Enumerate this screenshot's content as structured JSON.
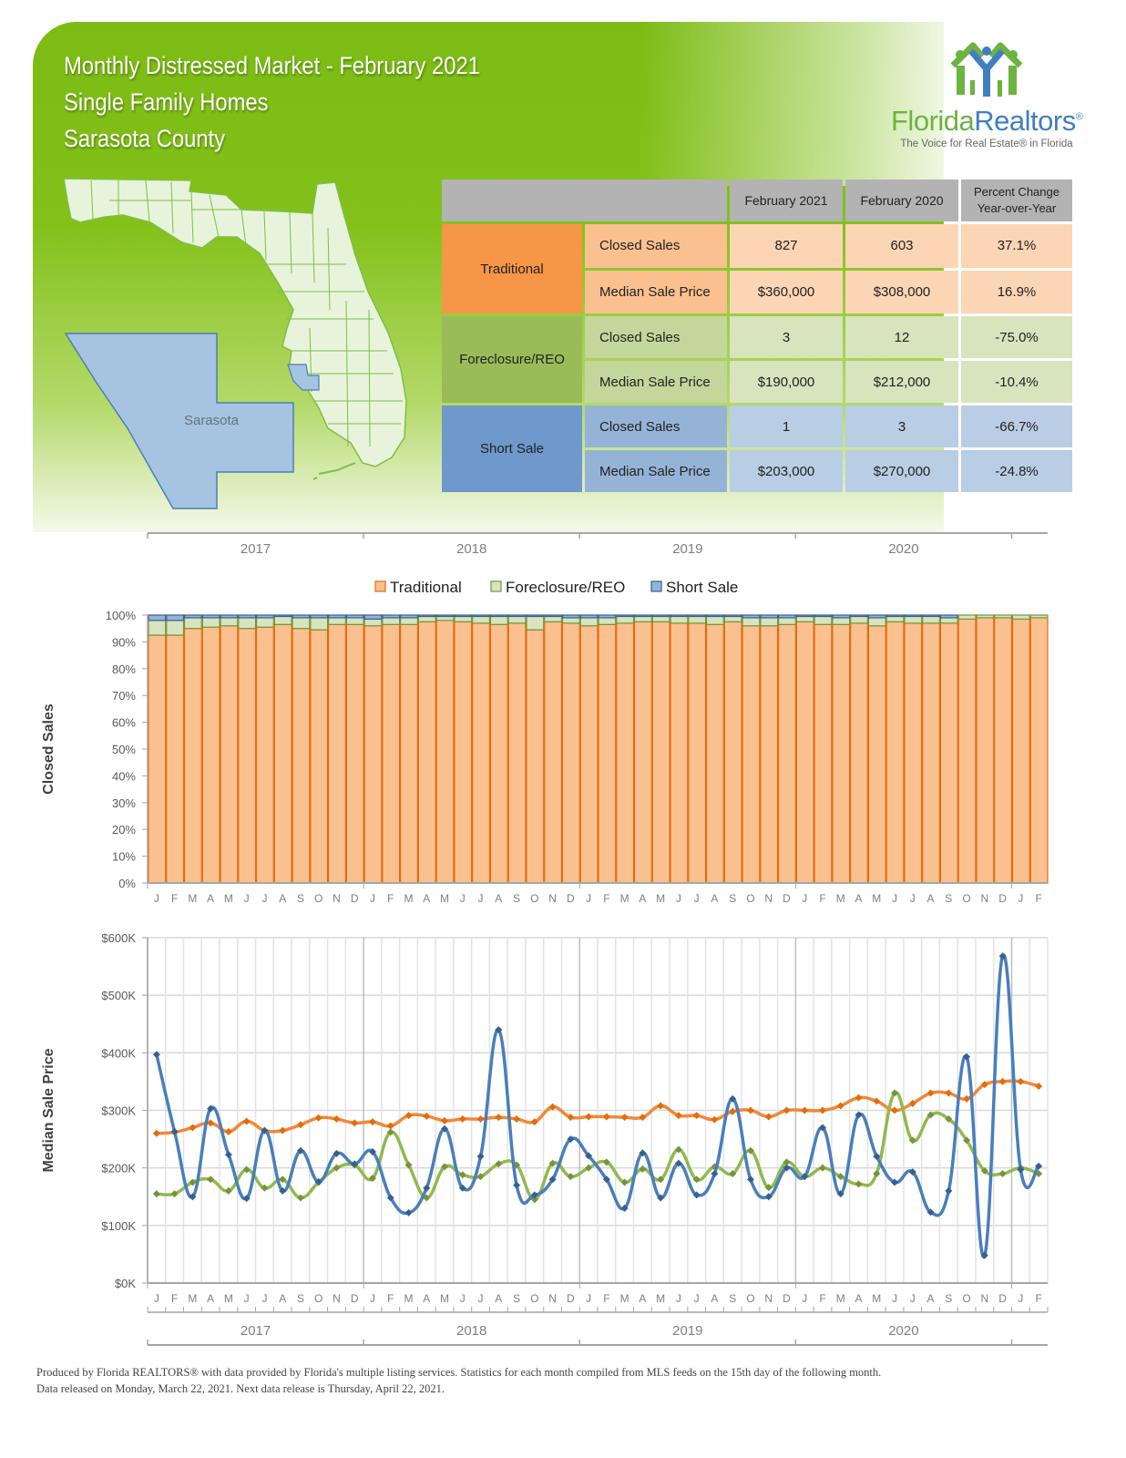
{
  "header": {
    "title_lines": [
      "Monthly Distressed Market - February 2021",
      "Single Family Homes",
      "Sarasota County"
    ]
  },
  "logo": {
    "icon": "houses-people-icon",
    "brand_part1": "Florida",
    "brand_part2": "Realtors",
    "registered": "®",
    "tagline": "The Voice for Real Estate® in Florida"
  },
  "map": {
    "region_label": "Sarasota",
    "state": "Florida",
    "colors": {
      "state_fill": "#e8f3dc",
      "state_border": "#7dbf44",
      "county_fill": "#a6c4e2",
      "county_border": "#4a7fb5"
    }
  },
  "summary_table": {
    "columns": [
      "February 2021",
      "February 2020",
      "Percent Change Year-over-Year"
    ],
    "pct_header_lines": [
      "Percent Change",
      "Year-over-Year"
    ],
    "groups": [
      {
        "category": "Traditional",
        "rows": [
          {
            "metric": "Closed Sales",
            "current": "827",
            "prior": "603",
            "change": "37.1%"
          },
          {
            "metric": "Median Sale Price",
            "current": "$360,000",
            "prior": "$308,000",
            "change": "16.9%"
          }
        ]
      },
      {
        "category": "Foreclosure/REO",
        "rows": [
          {
            "metric": "Closed Sales",
            "current": "3",
            "prior": "12",
            "change": "-75.0%"
          },
          {
            "metric": "Median Sale Price",
            "current": "$190,000",
            "prior": "$212,000",
            "change": "-10.4%"
          }
        ]
      },
      {
        "category": "Short Sale",
        "rows": [
          {
            "metric": "Closed Sales",
            "current": "1",
            "prior": "3",
            "change": "-66.7%"
          },
          {
            "metric": "Median Sale Price",
            "current": "$203,000",
            "prior": "$270,000",
            "change": "-24.8%"
          }
        ]
      }
    ]
  },
  "chart_data": [
    {
      "type": "bar",
      "stacked": "percent",
      "title": "",
      "ylabel": "Closed Sales",
      "xlabel": "",
      "ylim": [
        0,
        100
      ],
      "yticks": [
        "0%",
        "10%",
        "20%",
        "30%",
        "40%",
        "50%",
        "60%",
        "70%",
        "80%",
        "90%",
        "100%"
      ],
      "month_labels": [
        "J",
        "F",
        "M",
        "A",
        "M",
        "J",
        "J",
        "A",
        "S",
        "O",
        "N",
        "D",
        "J",
        "F",
        "M",
        "A",
        "M",
        "J",
        "J",
        "A",
        "S",
        "O",
        "N",
        "D",
        "J",
        "F",
        "M",
        "A",
        "M",
        "J",
        "J",
        "A",
        "S",
        "O",
        "N",
        "D",
        "J",
        "F",
        "M",
        "A",
        "M",
        "J",
        "J",
        "A",
        "S",
        "O",
        "N",
        "D",
        "J",
        "F"
      ],
      "year_labels": [
        "2017",
        "2018",
        "2019",
        "2020"
      ],
      "legend": [
        "Traditional",
        "Foreclosure/REO",
        "Short Sale"
      ],
      "legend_position": "top",
      "grid": true,
      "colors": {
        "Traditional": "#fac090",
        "Foreclosure/REO": "#d7e4bd",
        "Short Sale": "#95b3d7"
      },
      "border_colors": {
        "Traditional": "#e46c0a",
        "Foreclosure/REO": "#77933c",
        "Short Sale": "#376092"
      },
      "series": [
        {
          "name": "Traditional",
          "values": [
            92.5,
            92.5,
            95,
            95.5,
            96,
            95,
            95.5,
            96.5,
            95,
            94.5,
            96.5,
            96.5,
            96,
            96.5,
            96.5,
            97.5,
            98,
            97.5,
            97,
            96.5,
            97,
            94.5,
            97.5,
            97,
            96,
            96.5,
            97,
            97.5,
            97.5,
            97,
            97,
            96.5,
            97.5,
            96,
            96,
            96.5,
            97.5,
            96.5,
            96.5,
            97,
            96,
            97.5,
            97,
            97,
            97,
            98.5,
            99,
            99,
            98.5,
            99
          ]
        },
        {
          "name": "Foreclosure/REO",
          "values": [
            5.5,
            5.5,
            4,
            3.5,
            3,
            4,
            3.5,
            3,
            4,
            4.5,
            2.5,
            2.5,
            2.5,
            2.5,
            2.5,
            2,
            1.5,
            2,
            2.5,
            3,
            2.5,
            5,
            2,
            2,
            3,
            2.5,
            2.5,
            2,
            2,
            2.5,
            2.5,
            3,
            2,
            3,
            3,
            2.5,
            2,
            3,
            2.5,
            2.5,
            3,
            2,
            2.5,
            2.5,
            2,
            1.5,
            1,
            1,
            1.5,
            1
          ]
        },
        {
          "name": "Short Sale",
          "values": [
            2,
            2,
            1,
            1,
            1,
            1,
            1,
            0.5,
            1,
            1,
            1,
            1,
            1.5,
            1,
            1,
            0.5,
            0.5,
            0.5,
            0.5,
            0.5,
            0.5,
            0.5,
            0.5,
            1,
            1,
            1,
            0.5,
            0.5,
            0.5,
            0.5,
            0.5,
            0.5,
            0.5,
            1,
            1,
            1,
            0.5,
            0.5,
            1,
            0.5,
            1,
            0.5,
            0.5,
            0.5,
            1,
            0,
            0,
            0,
            0,
            0
          ]
        }
      ]
    },
    {
      "type": "line",
      "title": "",
      "ylabel": "Median Sale Price",
      "xlabel": "",
      "ylim": [
        0,
        600000
      ],
      "yticks": [
        "$0K",
        "$100K",
        "$200K",
        "$300K",
        "$400K",
        "$500K",
        "$600K"
      ],
      "month_labels": [
        "J",
        "F",
        "M",
        "A",
        "M",
        "J",
        "J",
        "A",
        "S",
        "O",
        "N",
        "D",
        "J",
        "F",
        "M",
        "A",
        "M",
        "J",
        "J",
        "A",
        "S",
        "O",
        "N",
        "D",
        "J",
        "F",
        "M",
        "A",
        "M",
        "J",
        "J",
        "A",
        "S",
        "O",
        "N",
        "D",
        "J",
        "F",
        "M",
        "A",
        "M",
        "J",
        "J",
        "A",
        "S",
        "O",
        "N",
        "D",
        "J",
        "F"
      ],
      "year_labels": [
        "2017",
        "2018",
        "2019",
        "2020"
      ],
      "grid": true,
      "colors": {
        "Traditional": "#f0883a",
        "Foreclosure/REO": "#8fba4e",
        "Short Sale": "#4a7ebb"
      },
      "series": [
        {
          "name": "Traditional",
          "values": [
            260000,
            262000,
            270000,
            278000,
            263000,
            281000,
            265000,
            265000,
            275000,
            287000,
            285000,
            278000,
            280000,
            273000,
            291000,
            290000,
            282000,
            285000,
            285000,
            288000,
            285000,
            280000,
            306000,
            288000,
            289000,
            289000,
            288000,
            288000,
            308000,
            291000,
            291000,
            284000,
            298000,
            300000,
            289000,
            300000,
            300000,
            300000,
            308000,
            322000,
            316000,
            300000,
            312000,
            330000,
            330000,
            320000,
            345000,
            350000,
            350000,
            342000
          ]
        },
        {
          "name": "Foreclosure/REO",
          "values": [
            155000,
            155000,
            175000,
            180000,
            160000,
            197000,
            165000,
            180000,
            148000,
            175000,
            200000,
            205000,
            182000,
            262000,
            205000,
            148000,
            202000,
            188000,
            185000,
            207000,
            205000,
            145000,
            208000,
            185000,
            200000,
            210000,
            175000,
            198000,
            180000,
            232000,
            180000,
            202000,
            190000,
            230000,
            166000,
            210000,
            185000,
            200000,
            185000,
            172000,
            190000,
            330000,
            248000,
            292000,
            285000,
            248000,
            195000,
            190000,
            200000,
            190000
          ]
        },
        {
          "name": "Short Sale",
          "values": [
            397000,
            263000,
            150000,
            303000,
            223000,
            147000,
            265000,
            160000,
            230000,
            176000,
            225000,
            207000,
            228000,
            148000,
            122000,
            165000,
            268000,
            165000,
            220000,
            440000,
            170000,
            153000,
            180000,
            250000,
            221000,
            180000,
            130000,
            226000,
            148000,
            208000,
            153000,
            190000,
            320000,
            180000,
            150000,
            200000,
            185000,
            270000,
            155000,
            292000,
            220000,
            175000,
            193000,
            123000,
            160000,
            393000,
            48000,
            568000,
            197000,
            203000
          ]
        }
      ]
    }
  ],
  "footer": {
    "line1": "Produced by Florida REALTORS® with data provided by Florida's multiple listing services. Statistics for each month compiled from MLS feeds on the 15th day of the following month.",
    "line2": "Data released on Monday, March 22, 2021. Next data release is Thursday, April 22, 2021."
  }
}
